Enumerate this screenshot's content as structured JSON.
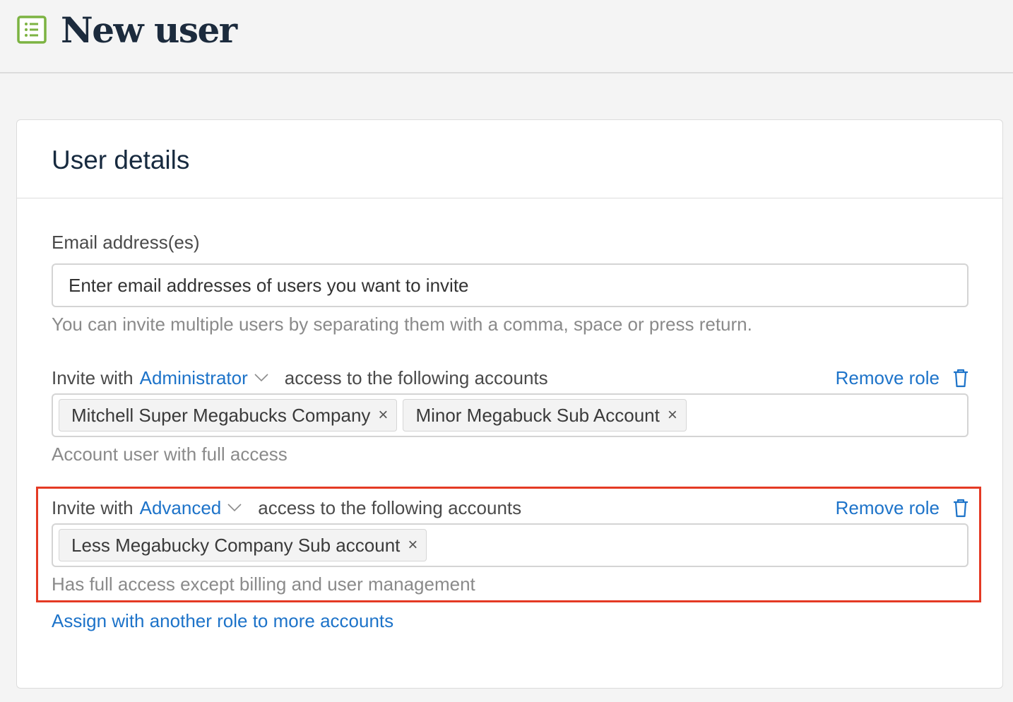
{
  "header": {
    "title": "New user",
    "icon": "list-document-icon"
  },
  "card": {
    "title": "User details",
    "email": {
      "label": "Email address(es)",
      "placeholder": "Enter email addresses of users you want to invite",
      "help": "You can invite multiple users by separating them with a comma, space or press return."
    },
    "roles": [
      {
        "prefix": "Invite with",
        "role": "Administrator",
        "suffix": "access to the following accounts",
        "remove_label": "Remove role",
        "accounts": [
          "Mitchell Super Megabucks Company",
          "Minor Megabuck Sub Account"
        ],
        "description": "Account user with full access"
      },
      {
        "prefix": "Invite with",
        "role": "Advanced",
        "suffix": "access to the following accounts",
        "remove_label": "Remove role",
        "accounts": [
          "Less Megabucky Company Sub account"
        ],
        "description": "Has full access except billing and user management"
      }
    ],
    "assign_link": "Assign with another role to more accounts",
    "tag_remove_glyph": "×"
  },
  "colors": {
    "link": "#1d73c9",
    "highlight": "#e43a24",
    "icon_green": "#7cb342",
    "title": "#1c2b3d"
  }
}
